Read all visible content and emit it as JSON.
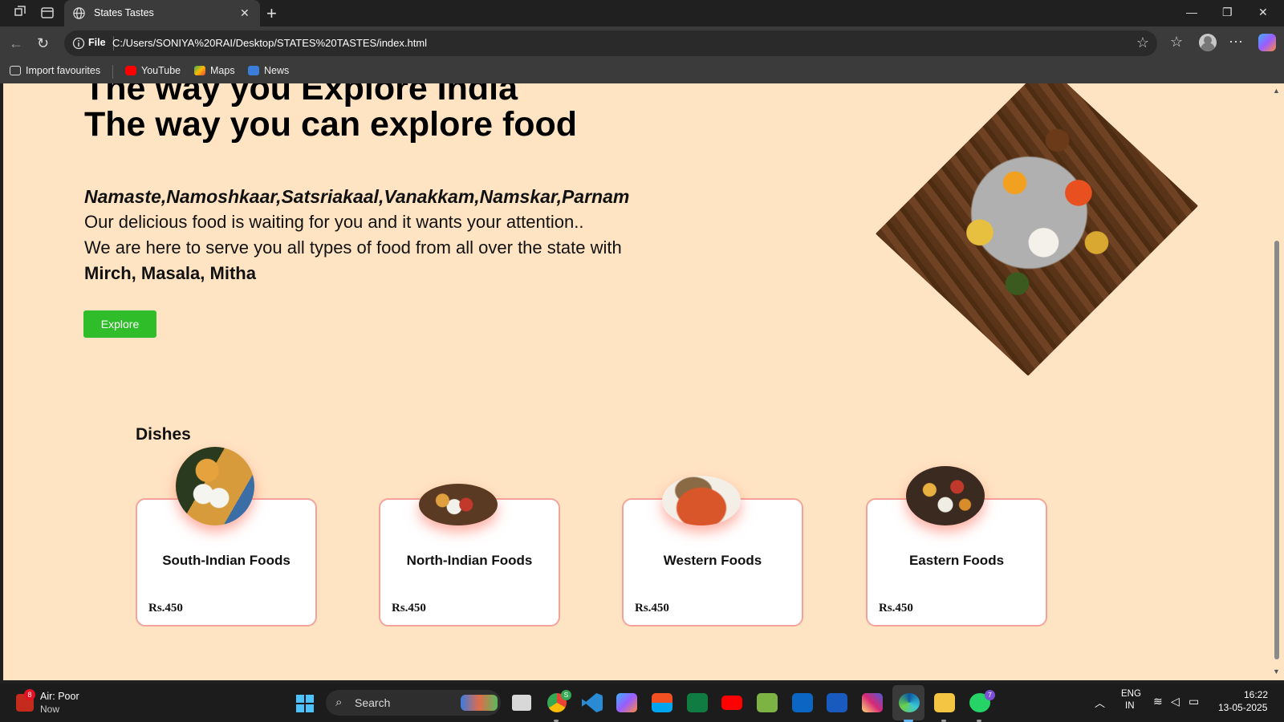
{
  "browser": {
    "tab_title": "States Tastes",
    "url_scheme_label": "File",
    "url": "C:/Users/SONIYA%20RAI/Desktop/STATES%20TASTES/index.html",
    "favourites": [
      {
        "label": "Import favourites",
        "icon": "import-icon"
      },
      {
        "label": "YouTube",
        "icon": "youtube-icon",
        "color": "#ff0000"
      },
      {
        "label": "Maps",
        "icon": "maps-icon",
        "color": "#34a853"
      },
      {
        "label": "News",
        "icon": "news-icon",
        "color": "#3b7dd8"
      }
    ]
  },
  "page": {
    "background": "#ffe4c4",
    "hero": {
      "heading_line1": "The way you Explore India",
      "heading_line2": "The way you can explore food",
      "greeting": "Namaste,Namoshkaar,Satsriakaal,Vanakkam,Namskar,Parnam",
      "line1": "Our delicious food is waiting for you and it wants your attention..",
      "line2": "We are here to serve you all types of food from all over the state with",
      "highlight": "Mirch, Masala, Mitha",
      "button_label": "Explore",
      "button_color": "#2fbd2a"
    },
    "dishes": {
      "title": "Dishes",
      "cards": [
        {
          "name": "South-Indian Foods",
          "price": "Rs.450"
        },
        {
          "name": "North-Indian Foods",
          "price": "Rs.450"
        },
        {
          "name": "Western Foods",
          "price": "Rs.450"
        },
        {
          "name": "Eastern Foods",
          "price": "Rs.450"
        }
      ],
      "card_border_color": "#f4a39b"
    }
  },
  "taskbar": {
    "weather_title": "Air: Poor",
    "weather_sub": "Now",
    "weather_badge": "8",
    "search_label": "Search",
    "chrome_badge": "S",
    "whatsapp_badge": "7",
    "lang_line1": "ENG",
    "lang_line2": "IN",
    "time": "16:22",
    "date": "13-05-2025",
    "apps": [
      "task-view-icon",
      "chrome-icon",
      "vscode-icon",
      "copilot-icon",
      "store-icon",
      "excel-icon",
      "youtube-icon",
      "notepad-icon",
      "linkedin-icon",
      "word-icon",
      "instagram-icon",
      "edge-icon",
      "file-explorer-icon",
      "whatsapp-icon"
    ]
  }
}
